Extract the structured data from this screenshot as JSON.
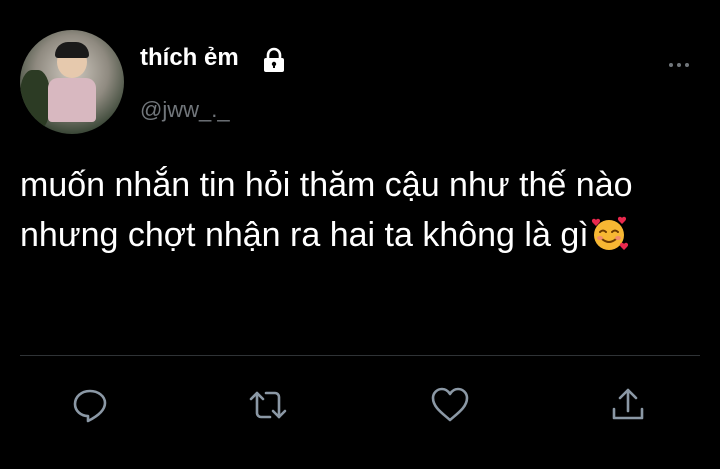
{
  "tweet": {
    "display_name": "thích ẻm",
    "handle": "@jww_._",
    "text_lines": [
      "muốn nhắn tin hỏi thăm cậu như thế nào",
      "nhưng chợt nhận ra hai ta không là gì"
    ]
  },
  "icons": {
    "lock": "lock-icon",
    "more": "more-options-icon",
    "emoji": "smiling-face-with-hearts-emoji",
    "reply": "reply-icon",
    "retweet": "retweet-icon",
    "like": "heart-icon",
    "share": "share-icon"
  },
  "colors": {
    "background": "#000000",
    "text": "#ffffff",
    "secondary_text": "#71767b",
    "divider": "#2f3336",
    "action_icon": "#8b98a5"
  }
}
